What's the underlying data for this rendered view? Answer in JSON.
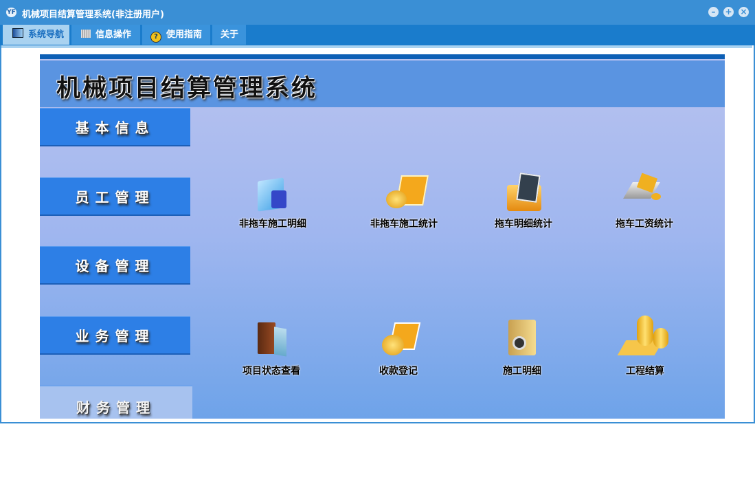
{
  "window": {
    "title": "机械项目结算管理系统(非注册用户)",
    "logo": "YF"
  },
  "tabs": [
    {
      "label": "系统导航",
      "icon": "monitor-icon"
    },
    {
      "label": "信息操作",
      "icon": "grid-icon"
    },
    {
      "label": "使用指南",
      "icon": "help-icon"
    },
    {
      "label": "关于"
    }
  ],
  "header": {
    "title": "机械项目结算管理系统"
  },
  "sidebar": [
    {
      "label": "基本信息"
    },
    {
      "label": "员工管理"
    },
    {
      "label": "设备管理"
    },
    {
      "label": "业务管理"
    },
    {
      "label": "财务管理"
    }
  ],
  "items": [
    {
      "label": "非拖车施工明细"
    },
    {
      "label": "非拖车施工统计"
    },
    {
      "label": "拖车明细统计"
    },
    {
      "label": "拖车工资统计"
    },
    {
      "label": "项目状态查看"
    },
    {
      "label": "收款登记"
    },
    {
      "label": "施工明细"
    },
    {
      "label": "工程结算"
    }
  ],
  "colors": {
    "accent": "#3a8fd5",
    "sidebar": "#2d7fe6",
    "header": "#5a94e1"
  }
}
